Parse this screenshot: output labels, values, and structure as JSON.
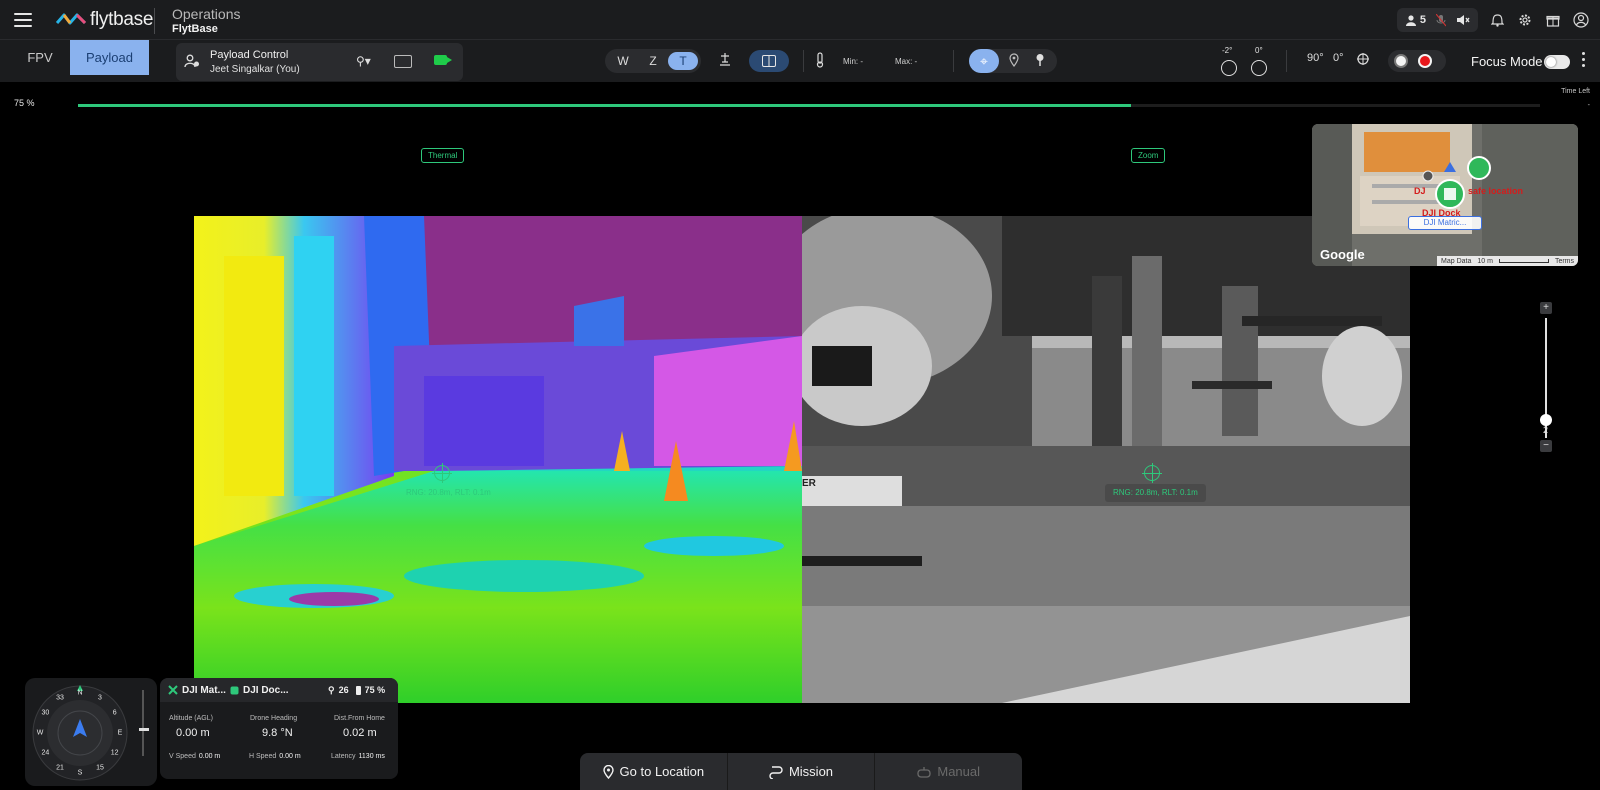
{
  "header": {
    "brand": "flytbase",
    "title": "Operations",
    "subtitle": "FlytBase",
    "users_count": "5"
  },
  "tabs": [
    {
      "label": "FPV"
    },
    {
      "label": "Payload",
      "active": true
    }
  ],
  "payload_control": {
    "title": "Payload Control",
    "user": "Jeet Singalkar (You)"
  },
  "camera_lens": {
    "options": [
      "W",
      "Z",
      "T"
    ],
    "selected": "T"
  },
  "temperature": {
    "min_label": "Min: -",
    "max_label": "Max: -"
  },
  "gimbal": {
    "pitch": "-2°",
    "yaw": "0°",
    "rotate_90": "90°",
    "rotate_0": "0°"
  },
  "focus_mode": {
    "label": "Focus Mode",
    "enabled": false
  },
  "progress": {
    "percent_label": "75 %",
    "fraction": 0.72,
    "time_left_label": "Time Left",
    "time_left_value": "-"
  },
  "views": {
    "thermal_label": "Thermal",
    "zoom_label": "Zoom",
    "thermal_rng": "RNG: 20.8m, RLT: 0.1m",
    "zoom_rng": "RNG: 20.8m, RLT: 0.1m",
    "zoom_overlay_text": "ER"
  },
  "minimap": {
    "google": "Google",
    "map_data": "Map Data",
    "scale": "10 m",
    "terms": "Terms",
    "dock_label": "DJI Dock",
    "safe_label": "safe location",
    "dj_label": "DJ",
    "drone_label": "DJI Matric..."
  },
  "zoom_slider": {
    "plus": "+",
    "minus": "−",
    "value": "2",
    "level_fraction": 0.15
  },
  "compass": {
    "ticks": [
      "N",
      "3",
      "6",
      "E",
      "12",
      "15",
      "S",
      "21",
      "24",
      "W",
      "30",
      "33"
    ]
  },
  "telemetry": {
    "drone_name": "DJI Mat...",
    "dock_name": "DJI Doc...",
    "satellites": "26",
    "battery": "75 %",
    "altitude_label": "Altitude (AGL)",
    "altitude_value": "0.00 m",
    "heading_label": "Drone Heading",
    "heading_value": "9.8 °N",
    "dist_label": "Dist.From Home",
    "dist_value": "0.02 m",
    "vspeed_label": "V Speed",
    "vspeed_value": "0.00 m",
    "hspeed_label": "H Speed",
    "hspeed_value": "0.00 m",
    "latency_label": "Latency",
    "latency_value": "1130 ms"
  },
  "actions": [
    {
      "label": "Go to Location",
      "icon": "map-pin-icon",
      "enabled": true
    },
    {
      "label": "Mission",
      "icon": "route-icon",
      "enabled": true
    },
    {
      "label": "Manual",
      "icon": "joystick-icon",
      "enabled": false
    }
  ],
  "colors": {
    "accent": "#8ab2ee",
    "green": "#2ec87b",
    "record_red": "#e8171b",
    "panel": "#1b1c1e"
  }
}
